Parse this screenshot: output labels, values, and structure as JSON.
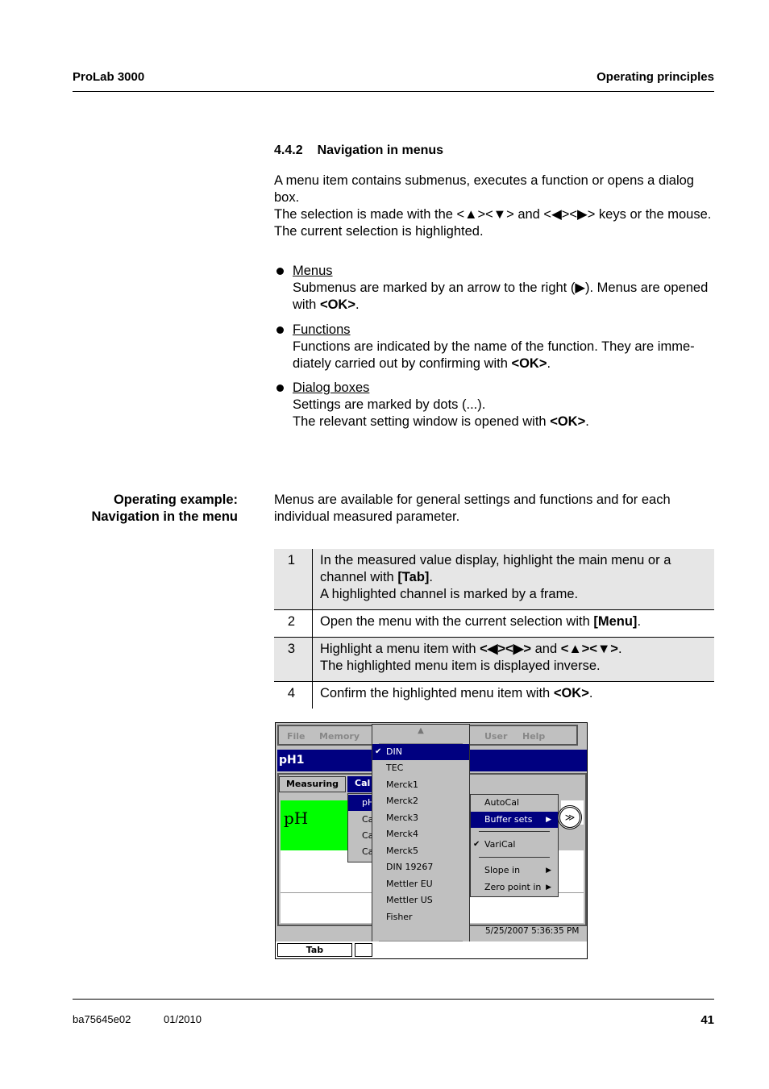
{
  "header": {
    "left": "ProLab 3000",
    "right": "Operating principles"
  },
  "section": {
    "number": "4.4.2",
    "title": "Navigation in menus",
    "paragraphs": [
      "A menu item contains submenus, executes a function or opens a dialog box.",
      "The selection is made with the <▲><▼> and <◀><▶> keys or the mouse.",
      "The current selection is highlighted."
    ],
    "bullets": [
      {
        "title": "Menus",
        "text_a": "Submenus are marked by an arrow to the right (▶). Menus are opened with ",
        "key": "<OK>",
        "text_b": "."
      },
      {
        "title": "Functions",
        "text_a": "Functions are indicated by the name of the function. They are imme-diately carried out by confirming with ",
        "key": "<OK>",
        "text_b": "."
      },
      {
        "title": "Dialog boxes",
        "text_a": "Settings are marked by dots (...).",
        "text_c": "The relevant setting window is opened with ",
        "key": "<OK>",
        "text_b": "."
      }
    ]
  },
  "example": {
    "side_label_1": "Operating example:",
    "side_label_2": "Navigation in the menu",
    "intro": "Menus are available for general settings and functions and for each individual measured parameter.",
    "steps": [
      {
        "num": "1",
        "a": "In the measured value display, highlight the main menu or a channel with ",
        "key": "[Tab]",
        "b": ".",
        "c": "A highlighted channel is marked by a frame."
      },
      {
        "num": "2",
        "a": "Open the menu with the current selection with ",
        "key": "[Menu]",
        "b": ".",
        "c": ""
      },
      {
        "num": "3",
        "a": "Highlight a menu item with ",
        "key": "<◀><▶>",
        "mid": " and ",
        "key2": "<▲><▼>",
        "b": ".",
        "c": "The highlighted menu item is displayed inverse."
      },
      {
        "num": "4",
        "a": "Confirm the highlighted menu item with ",
        "key": "<OK>",
        "b": ".",
        "c": ""
      }
    ]
  },
  "screen": {
    "menubar": [
      "File",
      "Memory",
      "User",
      "Help"
    ],
    "title": "pH1",
    "tabs": [
      "Measuring",
      "Cal"
    ],
    "display_label": "pH",
    "cal_menu": [
      "pH",
      "Ca",
      "Ca",
      "Ca"
    ],
    "buffer_list": [
      "DIN",
      "TEC",
      "Merck1",
      "Merck2",
      "Merck3",
      "Merck4",
      "Merck5",
      "DIN 19267",
      "Mettler EU",
      "Mettler US",
      "Fisher"
    ],
    "buffer_checked": "DIN",
    "cal_submenu": [
      "AutoCal",
      "Buffer sets",
      "VariCal",
      "Slope in",
      "Zero point in"
    ],
    "varical_checked": true,
    "datetime": "5/25/2007 5:36:35 PM",
    "softkey": "Tab"
  },
  "footer": {
    "doc_id": "ba75645e02",
    "date": "01/2010",
    "page": "41"
  }
}
